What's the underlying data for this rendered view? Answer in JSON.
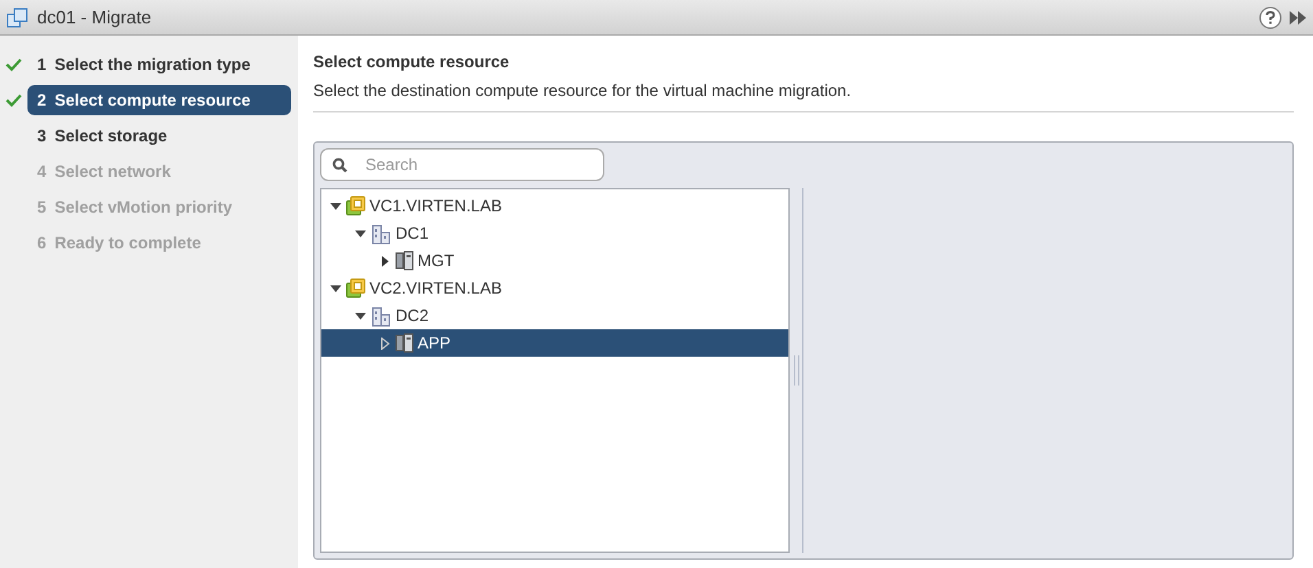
{
  "window": {
    "title": "dc01 - Migrate"
  },
  "steps": [
    {
      "number": "1",
      "label": "Select the migration type",
      "completed": true,
      "selected": false,
      "disabled": false
    },
    {
      "number": "2",
      "label": "Select compute resource",
      "completed": true,
      "selected": true,
      "disabled": false
    },
    {
      "number": "3",
      "label": "Select storage",
      "completed": false,
      "selected": false,
      "disabled": false
    },
    {
      "number": "4",
      "label": "Select network",
      "completed": false,
      "selected": false,
      "disabled": true
    },
    {
      "number": "5",
      "label": "Select vMotion priority",
      "completed": false,
      "selected": false,
      "disabled": true
    },
    {
      "number": "6",
      "label": "Ready to complete",
      "completed": false,
      "selected": false,
      "disabled": true
    }
  ],
  "page": {
    "title": "Select compute resource",
    "description": "Select the destination compute resource for the virtual machine migration."
  },
  "search": {
    "placeholder": "Search"
  },
  "tree": [
    {
      "kind": "vcenter",
      "label": "VC1.VIRTEN.LAB",
      "expanded": true,
      "selected": false,
      "children": [
        {
          "kind": "datacenter",
          "label": "DC1",
          "expanded": true,
          "selected": false,
          "children": [
            {
              "kind": "cluster",
              "label": "MGT",
              "expanded": false,
              "selected": false
            }
          ]
        }
      ]
    },
    {
      "kind": "vcenter",
      "label": "VC2.VIRTEN.LAB",
      "expanded": true,
      "selected": false,
      "children": [
        {
          "kind": "datacenter",
          "label": "DC2",
          "expanded": true,
          "selected": false,
          "children": [
            {
              "kind": "cluster",
              "label": "APP",
              "expanded": false,
              "selected": true
            }
          ]
        }
      ]
    }
  ]
}
